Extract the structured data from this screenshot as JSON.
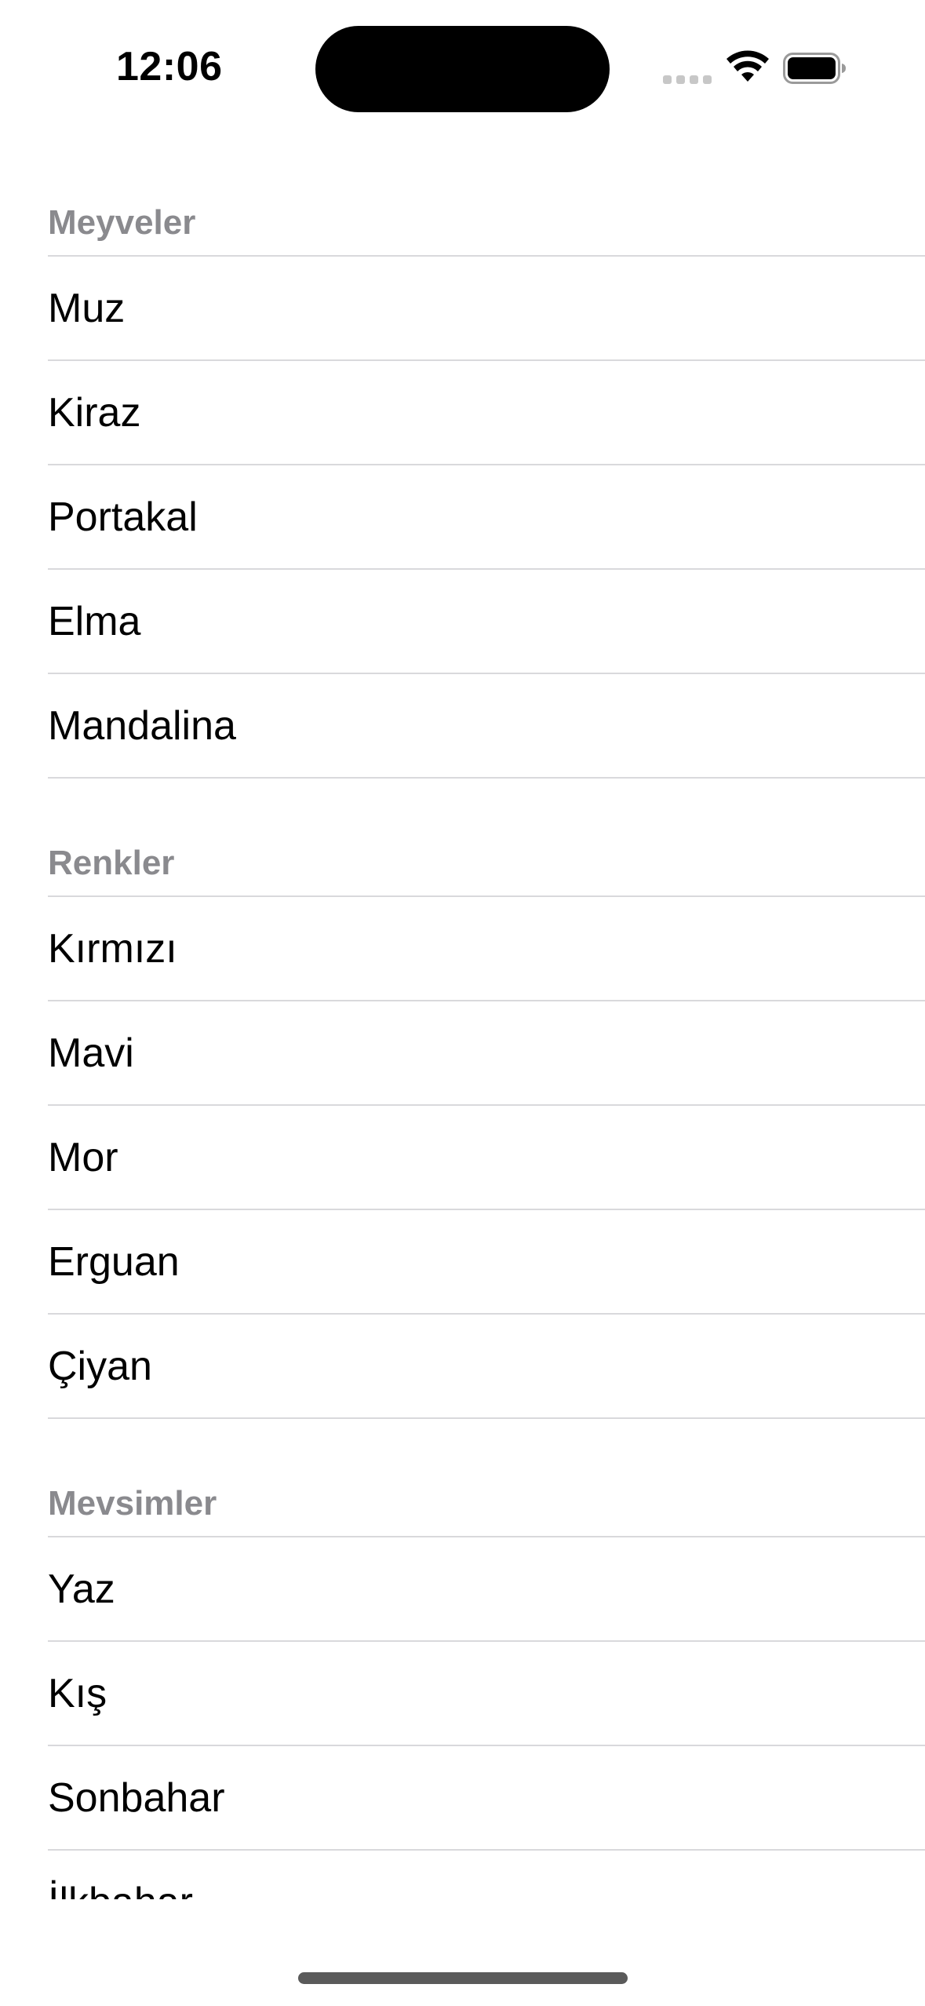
{
  "status_bar": {
    "time": "12:06",
    "icons": [
      "signal-dots-icon",
      "wifi-icon",
      "battery-icon"
    ]
  },
  "sections": [
    {
      "header": "Meyveler",
      "items": [
        "Muz",
        "Kiraz",
        "Portakal",
        "Elma",
        "Mandalina"
      ]
    },
    {
      "header": "Renkler",
      "items": [
        "Kırmızı",
        "Mavi",
        "Mor",
        "Erguan",
        "Çiyan"
      ]
    },
    {
      "header": "Mevsimler",
      "items": [
        "Yaz",
        "Kış",
        "Sonbahar",
        "İlkbahar"
      ]
    }
  ],
  "colors": {
    "header_text": "#8a8a8e",
    "separator": "#d9d9dc",
    "background": "#ffffff"
  }
}
